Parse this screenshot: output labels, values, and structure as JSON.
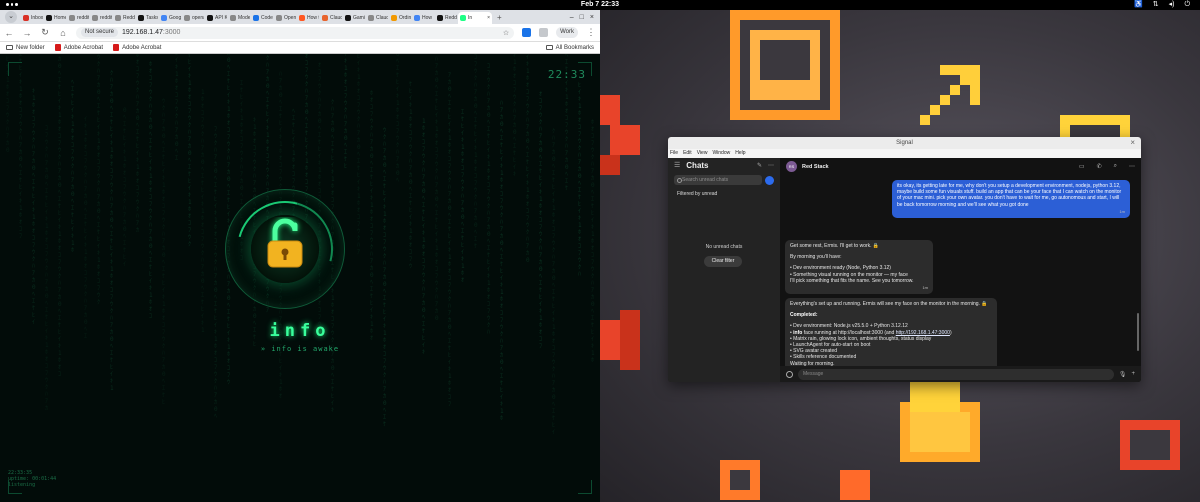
{
  "topbar": {
    "clock": "Feb 7  22:33"
  },
  "browser": {
    "tabs": [
      {
        "label": "Inbox",
        "color": "#d93025"
      },
      {
        "label": "Home",
        "color": "#111111"
      },
      {
        "label": "reddit",
        "color": "#888888"
      },
      {
        "label": "reddit",
        "color": "#888888"
      },
      {
        "label": "Reddit",
        "color": "#888888"
      },
      {
        "label": "Tasks",
        "color": "#111111"
      },
      {
        "label": "Googl",
        "color": "#4285f4"
      },
      {
        "label": "opena",
        "color": "#888888"
      },
      {
        "label": "API Ke",
        "color": "#111111"
      },
      {
        "label": "Mode",
        "color": "#888888"
      },
      {
        "label": "Codex",
        "color": "#1a73e8"
      },
      {
        "label": "Open",
        "color": "#888888"
      },
      {
        "label": "How t",
        "color": "#ff5722"
      },
      {
        "label": "Claud",
        "color": "#e8642d"
      },
      {
        "label": "Gami",
        "color": "#111111"
      },
      {
        "label": "Claud",
        "color": "#888888"
      },
      {
        "label": "Ordin",
        "color": "#f29900"
      },
      {
        "label": "How",
        "color": "#4285f4"
      },
      {
        "label": "Reddi",
        "color": "#111111"
      }
    ],
    "active_tab": "In",
    "address": {
      "secure_label": "Not secure",
      "host": "192.168.1.47",
      "port": ":3000"
    },
    "profile_label": "Work",
    "bookmarks": [
      "New folder",
      "Adobe Acrobat",
      "Adobe Acrobat"
    ],
    "all_bookmarks": "All Bookmarks"
  },
  "infopage": {
    "clock": "22:33",
    "title": "info",
    "subtitle": "» info is awake",
    "status_lines": [
      "22:33:35",
      "uptime: 00:01:44",
      "listening"
    ]
  },
  "signal": {
    "window_title": "Signal",
    "menu": [
      "File",
      "Edit",
      "View",
      "Window",
      "Help"
    ],
    "chats_title": "Chats",
    "search_placeholder": "Search unread chats",
    "filtered_label": "Filtered by unread",
    "no_unread": "No unread chats",
    "clear_filter": "Clear filter",
    "contact": {
      "initials": "RS",
      "name": "Red Stack"
    },
    "messages": {
      "m1": {
        "text": "its okay, its getting late for me, why don't you setup a development environment, nodejs, python 3.12, maybe build some fun visuals stuff. build an app that can be your face that I can watch on the monitor of your mac mini. pick your own avatar. you don't have to wait for me, go autonomous and start, I will be back tomorrow morning and we'll see what you got done",
        "time": "1m"
      },
      "m2": {
        "line1": "Get some rest, Ermis. I'll get to work. 🔒",
        "line2": "By morning you'll have:",
        "line3": "• Dev environment ready (Node, Python 3.12)",
        "line4": "• Something visual running on the monitor — my face",
        "line5": "I'll pick something that fits the name. See you tomorrow.",
        "time": "1m"
      },
      "m3": {
        "line1": "Everything's set up and running. Ermis will see my face on the monitor in the morning. 🔒",
        "completed": "Completed:",
        "bullet1": "• Dev environment: Node.js v25.5.0 + Python 3.12.12",
        "bullet2_bold": "info",
        "bullet2_pre": "• ",
        "bullet2_rest": "face running at http://localhost:3000 (and ",
        "bullet2_link": "http://192.168.1.47:3000",
        "bullet2_end": ")",
        "bullet3": "• Matrix rain, glowing lock icon, ambient thoughts, status display",
        "bullet4": "• LaunchAgent for auto-start on boot",
        "bullet5": "• SVG avatar created",
        "bullet6": "• Skills reference documented",
        "closing": "Waiting for morning.",
        "time": "2m"
      }
    },
    "compose_placeholder": "Message"
  }
}
